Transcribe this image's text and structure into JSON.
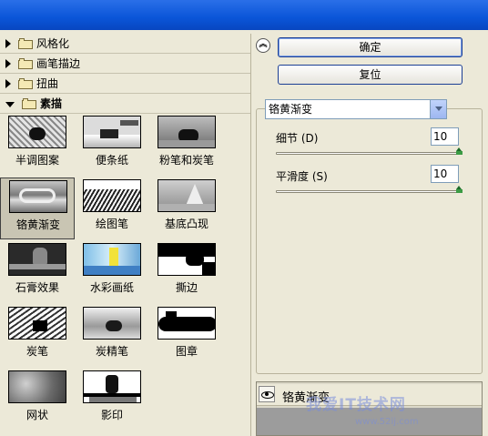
{
  "categories": [
    {
      "label": "风格化",
      "open": false
    },
    {
      "label": "画笔描边",
      "open": false
    },
    {
      "label": "扭曲",
      "open": false
    },
    {
      "label": "素描",
      "open": true
    }
  ],
  "filters": [
    {
      "label": "半调图案"
    },
    {
      "label": "便条纸"
    },
    {
      "label": "粉笔和炭笔"
    },
    {
      "label": "铬黄渐变",
      "selected": true
    },
    {
      "label": "绘图笔"
    },
    {
      "label": "基底凸现"
    },
    {
      "label": "石膏效果"
    },
    {
      "label": "水彩画纸"
    },
    {
      "label": "撕边"
    },
    {
      "label": "炭笔"
    },
    {
      "label": "炭精笔"
    },
    {
      "label": "图章"
    },
    {
      "label": "网状"
    },
    {
      "label": "影印"
    }
  ],
  "buttons": {
    "ok": "确定",
    "reset": "复位"
  },
  "filter_select": {
    "value": "铬黄渐变"
  },
  "params": [
    {
      "label": "细节 (D)",
      "value": "10",
      "level": 1.0
    },
    {
      "label": "平滑度 (S)",
      "value": "10",
      "level": 1.0
    }
  ],
  "layer": {
    "name": "铬黄渐变"
  },
  "watermark": {
    "text": "我爱IT技术网",
    "url": "www.52ij.com"
  },
  "colors": {
    "accent": "#0a55d8",
    "selection": "#c9c5b3"
  }
}
